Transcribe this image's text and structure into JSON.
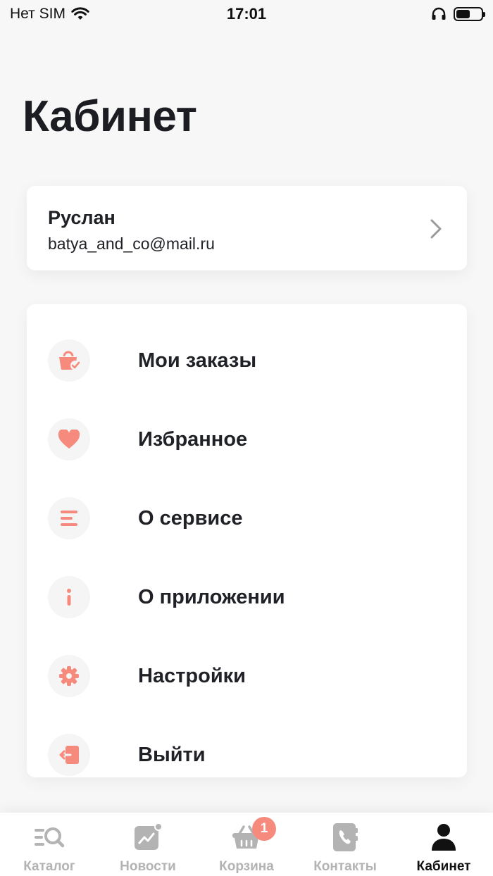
{
  "status_bar": {
    "carrier": "Нет SIM",
    "time": "17:01"
  },
  "page": {
    "title": "Кабинет"
  },
  "profile": {
    "name": "Руслан",
    "email": "batya_and_co@mail.ru"
  },
  "menu": {
    "items": [
      {
        "label": "Мои заказы",
        "icon": "orders-bag-icon"
      },
      {
        "label": "Избранное",
        "icon": "heart-icon"
      },
      {
        "label": "О сервисе",
        "icon": "lines-icon"
      },
      {
        "label": "О приложении",
        "icon": "info-icon"
      },
      {
        "label": "Настройки",
        "icon": "gear-icon"
      },
      {
        "label": "Выйти",
        "icon": "logout-icon"
      }
    ]
  },
  "tab_bar": {
    "tabs": [
      {
        "label": "Каталог",
        "icon": "catalog-search-icon"
      },
      {
        "label": "Новости",
        "icon": "news-chart-icon"
      },
      {
        "label": "Корзина",
        "icon": "basket-icon",
        "badge": "1"
      },
      {
        "label": "Контакты",
        "icon": "phone-book-icon"
      },
      {
        "label": "Кабинет",
        "icon": "user-icon",
        "active": true
      }
    ]
  },
  "colors": {
    "accent": "#f68a7c",
    "text": "#1f2126",
    "inactive": "#b3b3b3",
    "background": "#f7f7f7"
  }
}
